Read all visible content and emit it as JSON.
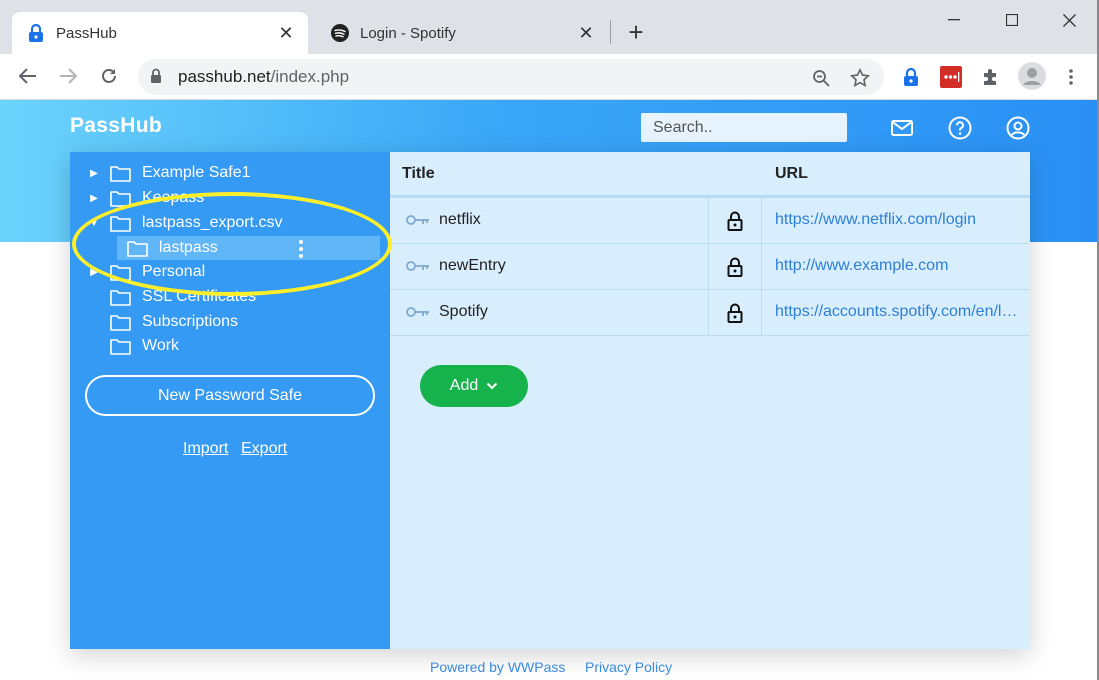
{
  "browser": {
    "tabs": [
      {
        "title": "PassHub",
        "icon": "passhub-lock-icon",
        "active": true
      },
      {
        "title": "Login - Spotify",
        "icon": "spotify-icon",
        "active": false
      }
    ],
    "new_tab": "+",
    "url_host": "passhub.net",
    "url_path": "/index.php"
  },
  "app": {
    "logo": "PassHub",
    "search_placeholder": "Search..",
    "colors": {
      "accent": "#349af3",
      "add_button": "#16b24b",
      "highlight": "#ffef2a"
    }
  },
  "sidebar": {
    "folders": [
      {
        "label": "Example Safe1",
        "has_arrow": true,
        "arrow": "▶"
      },
      {
        "label": "Keepass",
        "has_arrow": true,
        "arrow": "▶"
      },
      {
        "label": "lastpass_export.csv",
        "has_arrow": true,
        "arrow": "▼"
      },
      {
        "label": "lastpass",
        "selected": true
      },
      {
        "label": "Personal",
        "has_arrow": true,
        "arrow": "▶"
      },
      {
        "label": "SSL Certificates"
      },
      {
        "label": "Subscriptions"
      },
      {
        "label": "Work"
      }
    ],
    "new_safe_label": "New Password Safe",
    "import_label": "Import",
    "export_label": "Export"
  },
  "table": {
    "col_title": "Title",
    "col_url": "URL",
    "rows": [
      {
        "title": "netflix",
        "url": "https://www.netflix.com/login"
      },
      {
        "title": "newEntry",
        "url": "http://www.example.com"
      },
      {
        "title": "Spotify",
        "url": "https://accounts.spotify.com/en/login"
      }
    ],
    "add_label": "Add"
  },
  "footer": {
    "powered": "Powered by WWPass",
    "privacy": "Privacy Policy"
  }
}
